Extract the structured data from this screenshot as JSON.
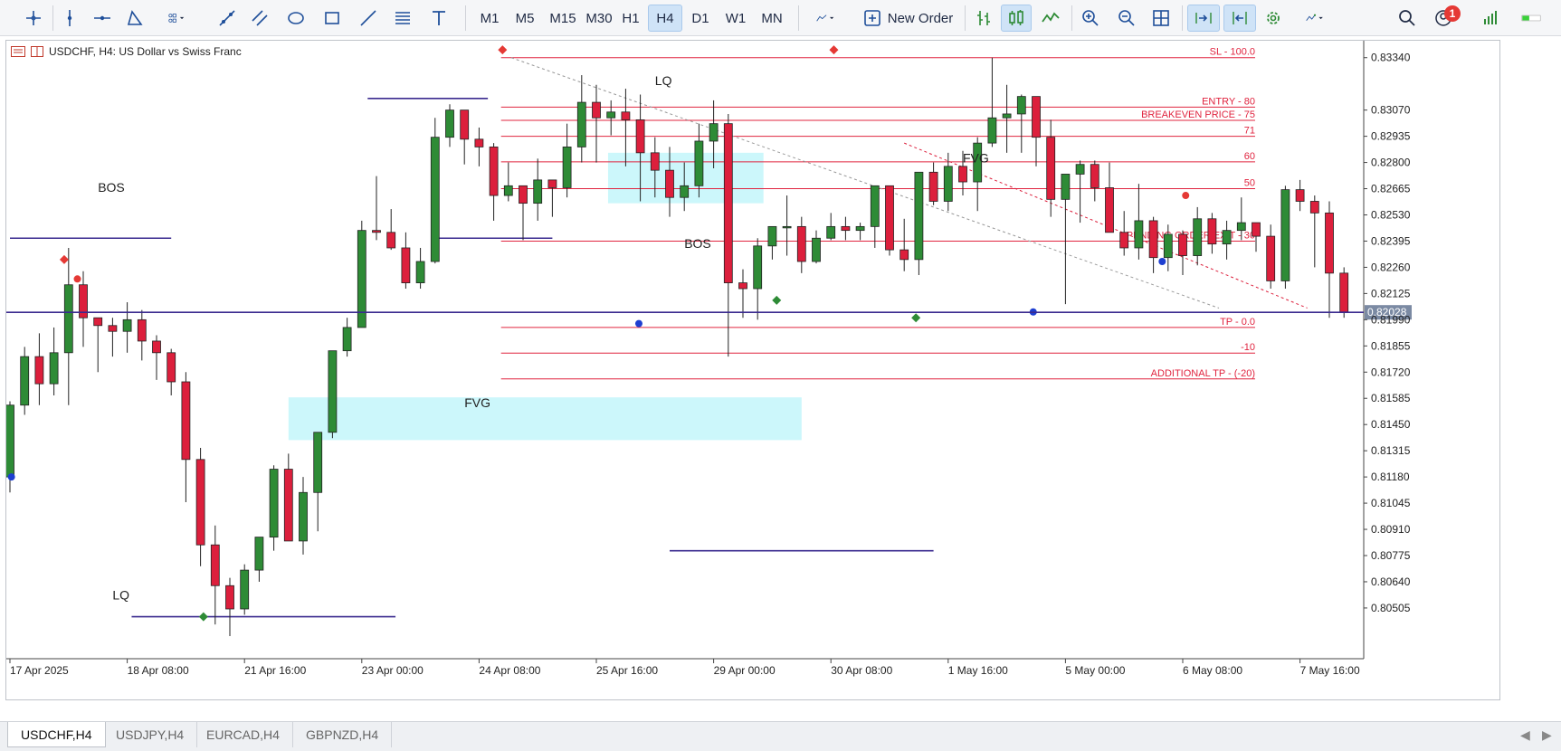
{
  "toolbar": {
    "timeframes": [
      "M1",
      "M5",
      "M15",
      "M30",
      "H1",
      "H4",
      "D1",
      "W1",
      "MN"
    ],
    "active_timeframe": "H4",
    "new_order_label": "New Order",
    "notification_count": "1"
  },
  "symbol_info": {
    "label": "USDCHF, H4:  US Dollar vs Swiss Franc"
  },
  "tabs": [
    "USDCHF,H4",
    "USDJPY,H4",
    "EURCAD,H4",
    "GBPNZD,H4"
  ],
  "active_tab": "USDCHF,H4",
  "colors": {
    "bull": "#2e8b36",
    "bear": "#dc1f3c",
    "level": "#e0243f",
    "structure": "#3a2a8f",
    "fvg": "#ccf7fb",
    "price_line": "#3a2a8f"
  },
  "chart_data": {
    "type": "candlestick",
    "symbol": "USDCHF",
    "timeframe": "H4",
    "ylim": [
      0.804,
      0.834
    ],
    "y_ticks": [
      0.8334,
      0.8307,
      0.82935,
      0.828,
      0.82665,
      0.8253,
      0.82395,
      0.8226,
      0.82125,
      0.8199,
      0.81855,
      0.8172,
      0.81585,
      0.8145,
      0.81315,
      0.8118,
      0.81045,
      0.8091,
      0.80775,
      0.8064,
      0.80505
    ],
    "x_ticks": [
      {
        "label": "17 Apr 2025",
        "index": 0
      },
      {
        "label": "18 Apr 08:00",
        "index": 8
      },
      {
        "label": "21 Apr 16:00",
        "index": 16
      },
      {
        "label": "23 Apr 00:00",
        "index": 24
      },
      {
        "label": "24 Apr 08:00",
        "index": 32
      },
      {
        "label": "25 Apr 16:00",
        "index": 40
      },
      {
        "label": "29 Apr 00:00",
        "index": 48
      },
      {
        "label": "30 Apr 08:00",
        "index": 56
      },
      {
        "label": "1 May 16:00",
        "index": 64
      },
      {
        "label": "5 May 00:00",
        "index": 72
      },
      {
        "label": "6 May 08:00",
        "index": 80
      },
      {
        "label": "7 May 16:00",
        "index": 88
      }
    ],
    "candles": [
      [
        0.8118,
        0.8157,
        0.811,
        0.8155
      ],
      [
        0.8155,
        0.8185,
        0.815,
        0.818
      ],
      [
        0.818,
        0.8192,
        0.8155,
        0.8166
      ],
      [
        0.8166,
        0.8195,
        0.816,
        0.8182
      ],
      [
        0.8182,
        0.8236,
        0.8155,
        0.8217
      ],
      [
        0.8217,
        0.8224,
        0.8185,
        0.82
      ],
      [
        0.82,
        0.82,
        0.8172,
        0.8196
      ],
      [
        0.8196,
        0.82,
        0.818,
        0.8193
      ],
      [
        0.8193,
        0.8208,
        0.8182,
        0.8199
      ],
      [
        0.8199,
        0.8204,
        0.8178,
        0.8188
      ],
      [
        0.8188,
        0.8191,
        0.8168,
        0.8182
      ],
      [
        0.8182,
        0.8184,
        0.816,
        0.8167
      ],
      [
        0.8167,
        0.8172,
        0.8105,
        0.8127
      ],
      [
        0.8127,
        0.8133,
        0.8072,
        0.8083
      ],
      [
        0.8083,
        0.8093,
        0.8042,
        0.8062
      ],
      [
        0.8062,
        0.8066,
        0.8036,
        0.805
      ],
      [
        0.805,
        0.8073,
        0.8047,
        0.807
      ],
      [
        0.807,
        0.8086,
        0.8064,
        0.8087
      ],
      [
        0.8087,
        0.8124,
        0.808,
        0.8122
      ],
      [
        0.8122,
        0.813,
        0.8085,
        0.8085
      ],
      [
        0.8085,
        0.8118,
        0.8078,
        0.811
      ],
      [
        0.811,
        0.8136,
        0.809,
        0.8141
      ],
      [
        0.8141,
        0.8176,
        0.8138,
        0.8183
      ],
      [
        0.8183,
        0.82,
        0.818,
        0.8195
      ],
      [
        0.8195,
        0.825,
        0.8195,
        0.8245
      ],
      [
        0.8245,
        0.8273,
        0.824,
        0.8244
      ],
      [
        0.8244,
        0.8256,
        0.8235,
        0.8236
      ],
      [
        0.8236,
        0.8244,
        0.8215,
        0.8218
      ],
      [
        0.8218,
        0.8236,
        0.8215,
        0.8229
      ],
      [
        0.8229,
        0.8303,
        0.8228,
        0.8293
      ],
      [
        0.8293,
        0.831,
        0.8288,
        0.8307
      ],
      [
        0.8307,
        0.8297,
        0.8279,
        0.8292
      ],
      [
        0.8292,
        0.8298,
        0.8278,
        0.8288
      ],
      [
        0.8288,
        0.829,
        0.825,
        0.8263
      ],
      [
        0.8263,
        0.828,
        0.826,
        0.8268
      ],
      [
        0.8268,
        0.826,
        0.824,
        0.8259
      ],
      [
        0.8259,
        0.8282,
        0.825,
        0.8271
      ],
      [
        0.8271,
        0.8268,
        0.8252,
        0.8267
      ],
      [
        0.8267,
        0.83,
        0.8262,
        0.8288
      ],
      [
        0.8288,
        0.8325,
        0.828,
        0.8311
      ],
      [
        0.8311,
        0.832,
        0.828,
        0.8303
      ],
      [
        0.8303,
        0.8312,
        0.8294,
        0.8306
      ],
      [
        0.8306,
        0.8318,
        0.8278,
        0.8302
      ],
      [
        0.8302,
        0.8315,
        0.826,
        0.8285
      ],
      [
        0.8285,
        0.8293,
        0.8262,
        0.8276
      ],
      [
        0.8276,
        0.8288,
        0.8252,
        0.8262
      ],
      [
        0.8262,
        0.828,
        0.8255,
        0.8268
      ],
      [
        0.8268,
        0.83,
        0.8262,
        0.8291
      ],
      [
        0.8291,
        0.8312,
        0.8277,
        0.83
      ],
      [
        0.83,
        0.8305,
        0.818,
        0.8218
      ],
      [
        0.8218,
        0.8225,
        0.82,
        0.8215
      ],
      [
        0.8215,
        0.8241,
        0.8199,
        0.8237
      ],
      [
        0.8237,
        0.8246,
        0.823,
        0.8247
      ],
      [
        0.8247,
        0.8263,
        0.8232,
        0.8247
      ],
      [
        0.8247,
        0.8252,
        0.8223,
        0.8229
      ],
      [
        0.8229,
        0.8245,
        0.8228,
        0.8241
      ],
      [
        0.8241,
        0.8254,
        0.824,
        0.8247
      ],
      [
        0.8247,
        0.8252,
        0.824,
        0.8245
      ],
      [
        0.8245,
        0.8249,
        0.824,
        0.8247
      ],
      [
        0.8247,
        0.8262,
        0.8236,
        0.8268
      ],
      [
        0.8268,
        0.8265,
        0.8232,
        0.8235
      ],
      [
        0.8235,
        0.8251,
        0.8224,
        0.823
      ],
      [
        0.823,
        0.8244,
        0.8222,
        0.8275
      ],
      [
        0.8275,
        0.828,
        0.8258,
        0.826
      ],
      [
        0.826,
        0.8285,
        0.8255,
        0.8278
      ],
      [
        0.8278,
        0.8286,
        0.8263,
        0.827
      ],
      [
        0.827,
        0.8293,
        0.8255,
        0.829
      ],
      [
        0.829,
        0.8334,
        0.8288,
        0.8303
      ],
      [
        0.8303,
        0.832,
        0.8285,
        0.8305
      ],
      [
        0.8305,
        0.8315,
        0.8285,
        0.8314
      ],
      [
        0.8314,
        0.8312,
        0.8278,
        0.8293
      ],
      [
        0.8293,
        0.8302,
        0.8252,
        0.8261
      ],
      [
        0.8261,
        0.827,
        0.8207,
        0.8274
      ],
      [
        0.8274,
        0.8281,
        0.8249,
        0.8279
      ],
      [
        0.8279,
        0.8281,
        0.826,
        0.8267
      ],
      [
        0.8267,
        0.828,
        0.8261,
        0.8244
      ],
      [
        0.8244,
        0.8255,
        0.8232,
        0.8236
      ],
      [
        0.8236,
        0.8269,
        0.823,
        0.825
      ],
      [
        0.825,
        0.8252,
        0.8223,
        0.8231
      ],
      [
        0.8231,
        0.8248,
        0.8224,
        0.8243
      ],
      [
        0.8243,
        0.8245,
        0.8222,
        0.8232
      ],
      [
        0.8232,
        0.8257,
        0.8227,
        0.8251
      ],
      [
        0.8251,
        0.8254,
        0.8233,
        0.8238
      ],
      [
        0.8238,
        0.825,
        0.823,
        0.8245
      ],
      [
        0.8245,
        0.8262,
        0.824,
        0.8249
      ],
      [
        0.8249,
        0.8246,
        0.8234,
        0.8242
      ],
      [
        0.8242,
        0.8248,
        0.8215,
        0.8219
      ],
      [
        0.8219,
        0.8268,
        0.8215,
        0.8266
      ],
      [
        0.8266,
        0.8271,
        0.8255,
        0.826
      ],
      [
        0.826,
        0.8263,
        0.8226,
        0.8254
      ],
      [
        0.8254,
        0.826,
        0.82,
        0.8223
      ],
      [
        0.8223,
        0.8226,
        0.82,
        0.8203
      ]
    ],
    "levels": [
      {
        "label": "SL - 100.0",
        "price": 0.8334
      },
      {
        "label": "ENTRY - 80",
        "price": 0.83085
      },
      {
        "label": "BREAKEVEN PRICE - 75",
        "price": 0.83017
      },
      {
        "label": "71",
        "price": 0.82935
      },
      {
        "label": "60",
        "price": 0.82803
      },
      {
        "label": "50",
        "price": 0.82665
      },
      {
        "label": "PENDING ORDER EXIT - 30",
        "price": 0.82395
      },
      {
        "label": "TP - 0.0",
        "price": 0.8195
      },
      {
        "label": "-10",
        "price": 0.81818
      },
      {
        "label": "ADDITIONAL TP - (-20)",
        "price": 0.81685
      }
    ],
    "current_price": "0.82028",
    "annotations": [
      {
        "text": "LQ",
        "index": 44,
        "price": 0.832
      },
      {
        "text": "BOS",
        "index": 6,
        "price": 0.8265
      },
      {
        "text": "BOS",
        "index": 46,
        "price": 0.8236
      },
      {
        "text": "FVG",
        "index": 65,
        "price": 0.828
      },
      {
        "text": "FVG",
        "index": 31,
        "price": 0.8154
      },
      {
        "text": "LQ",
        "index": 7,
        "price": 0.8055
      }
    ]
  }
}
